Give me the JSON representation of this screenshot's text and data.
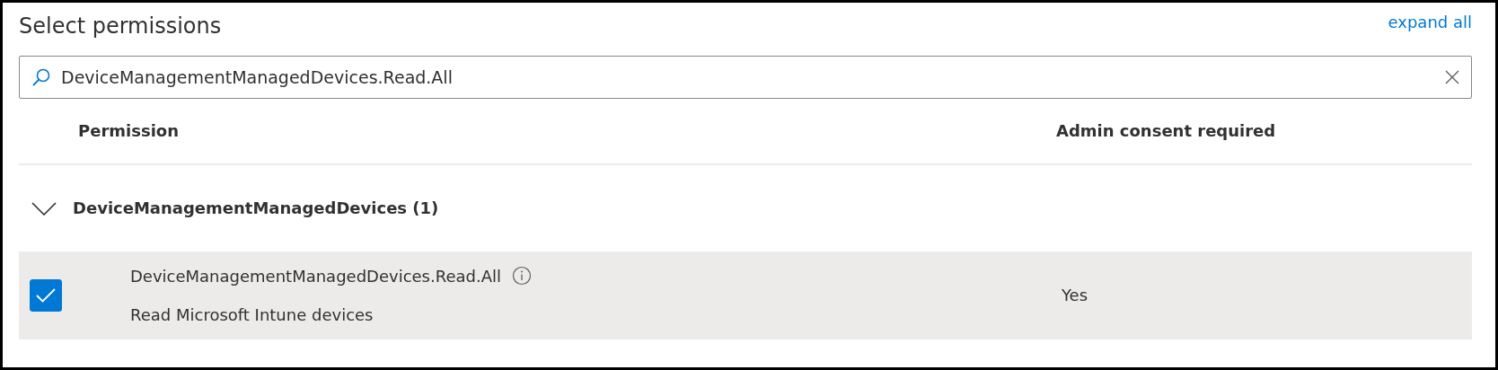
{
  "title": "Select permissions",
  "expand_link": "expand all",
  "search": {
    "value": "DeviceManagementManagedDevices.Read.All"
  },
  "table": {
    "columns": [
      "Permission",
      "Admin consent required"
    ],
    "groups": [
      {
        "label": "DeviceManagementManagedDevices (1)",
        "expanded": true,
        "rows": [
          {
            "name": "DeviceManagementManagedDevices.Read.All",
            "description": "Read Microsoft Intune devices",
            "admin_consent": "Yes",
            "checked": true,
            "selected": true
          }
        ]
      }
    ]
  }
}
